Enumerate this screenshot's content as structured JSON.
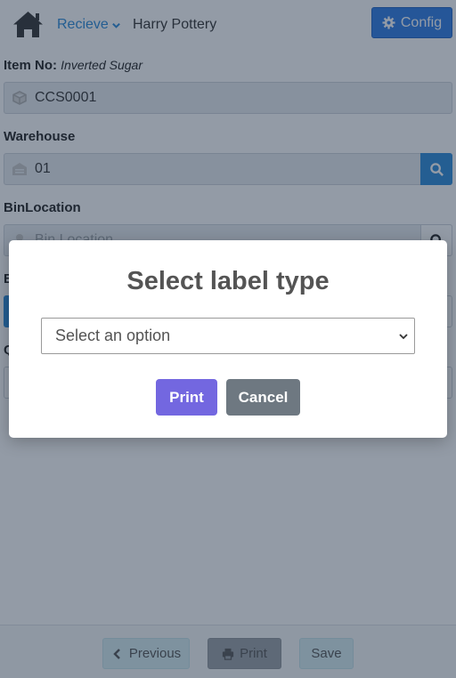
{
  "header": {
    "nav_label": "Recieve",
    "user_name": "Harry Pottery",
    "config_label": "Config"
  },
  "form": {
    "item_label": "Item No:",
    "item_desc": "Inverted Sugar",
    "item_value": "CCS0001",
    "warehouse_label": "Warehouse",
    "warehouse_value": "01",
    "bin_label": "BinLocation",
    "bin_placeholder": "Bin Location",
    "partial_label_b": "B",
    "partial_label_q": "Q"
  },
  "footer": {
    "previous_label": "Previous",
    "print_label": "Print",
    "save_label": "Save"
  },
  "modal": {
    "title": "Select label type",
    "select_value": "Select an option",
    "print_label": "Print",
    "cancel_label": "Cancel"
  },
  "icons": {
    "home": "home-icon",
    "chevron": "chevron-down-icon",
    "config": "gear-icon",
    "item": "cube-icon",
    "warehouse": "warehouse-icon",
    "bin": "user-icon",
    "search": "search-icon",
    "previous": "chevron-left-icon",
    "print": "printer-icon"
  },
  "colors": {
    "accent": "#2c7be5",
    "nav_link": "#2b8ad8",
    "modal_print": "#7367e0",
    "modal_cancel": "#6e7881"
  }
}
